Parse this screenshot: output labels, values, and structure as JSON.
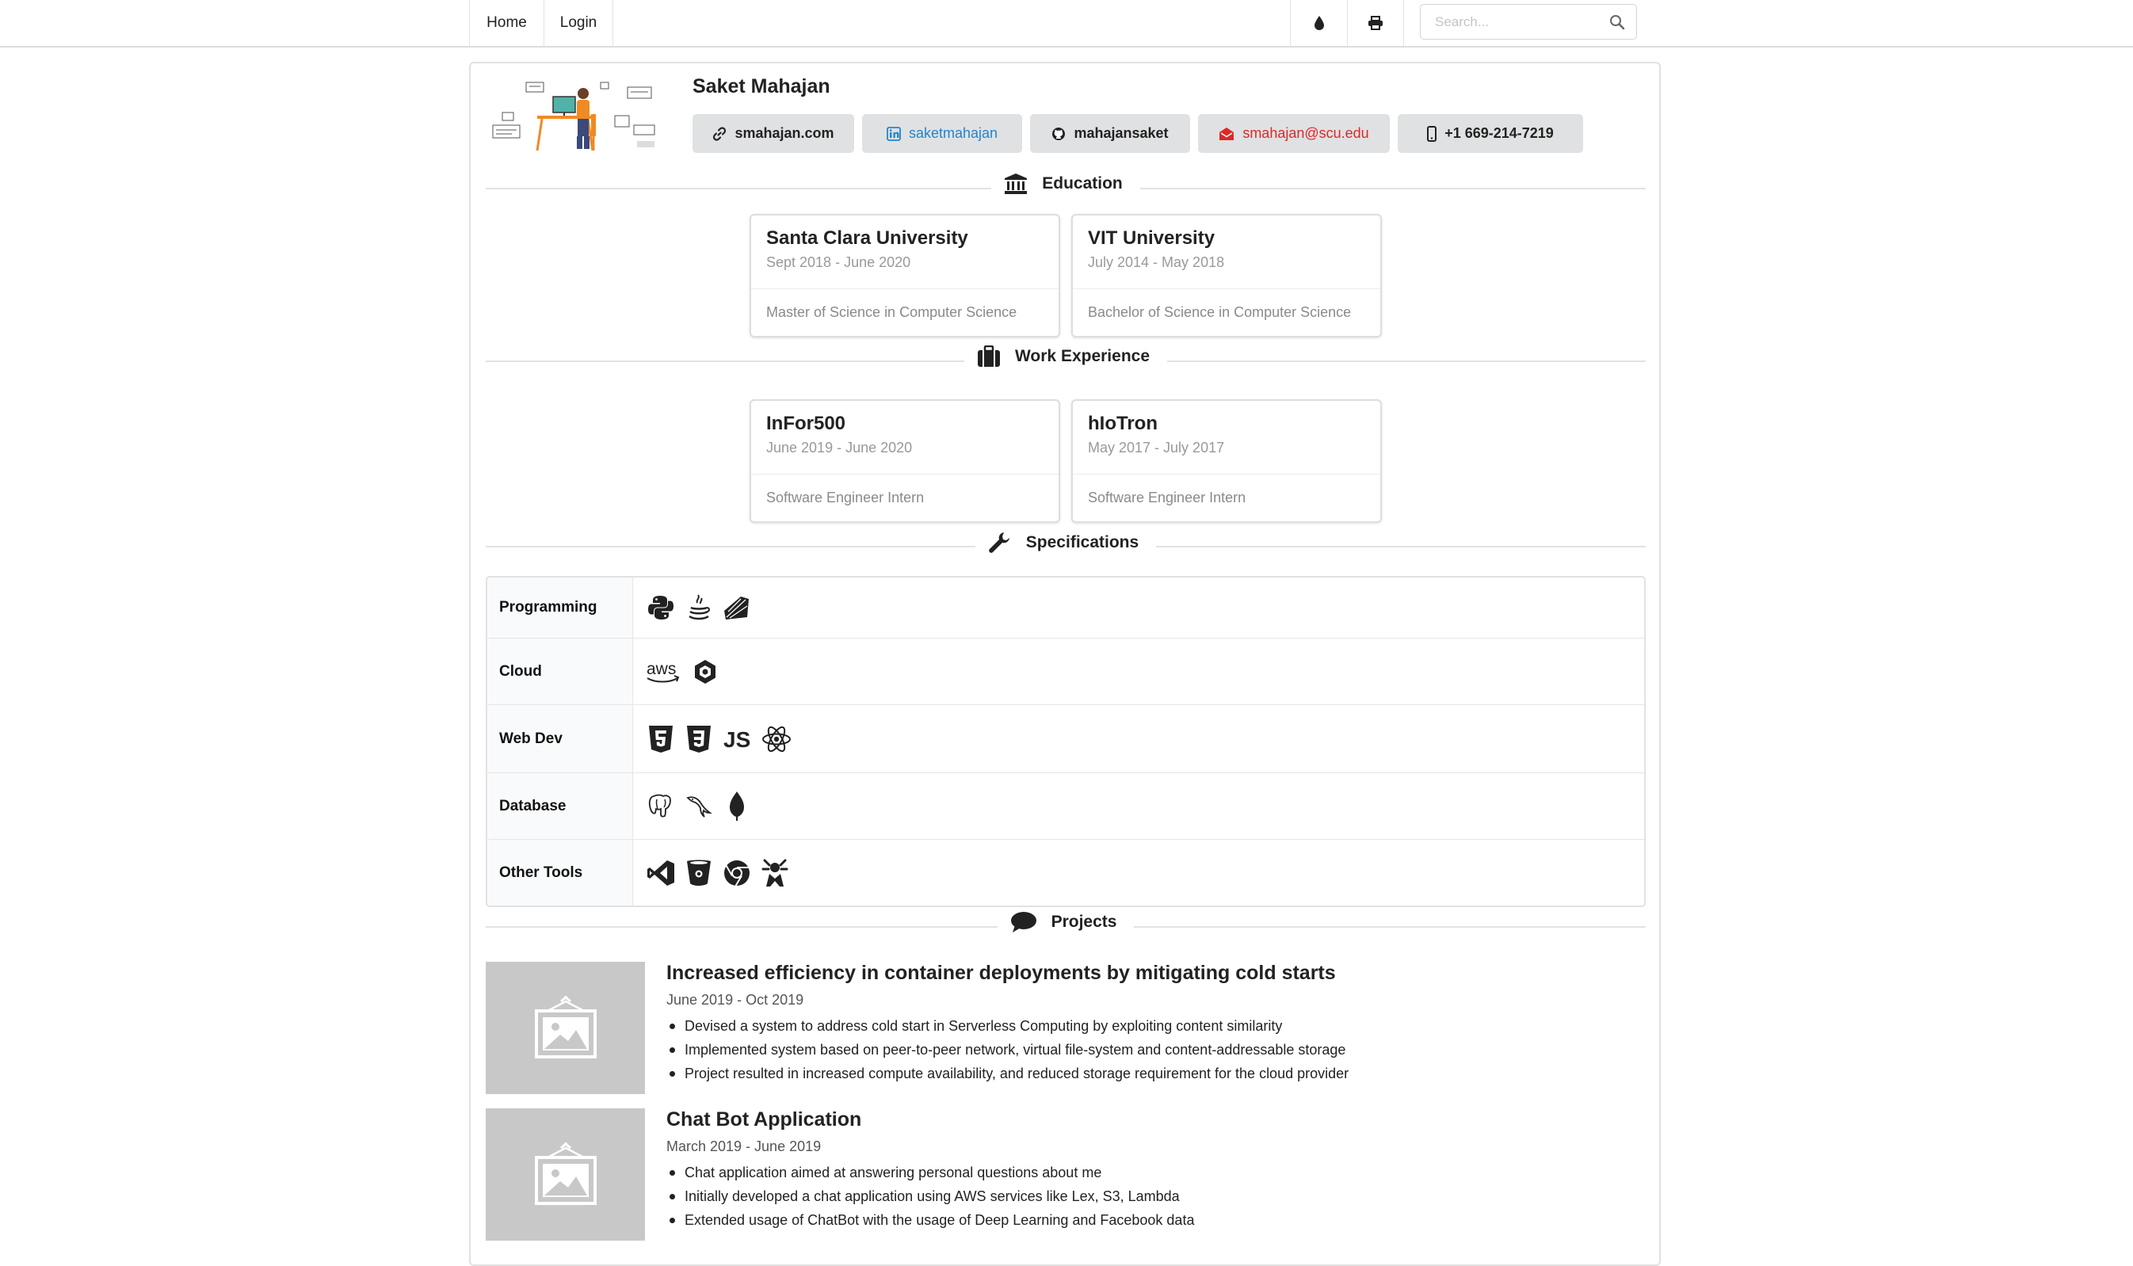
{
  "nav": {
    "home": "Home",
    "login": "Login",
    "theme_icon": "droplet-icon",
    "print_icon": "print-icon",
    "search_placeholder": "Search..."
  },
  "profile": {
    "name": "Saket Mahajan",
    "avatar": "developer-illustration",
    "contacts": [
      {
        "label": "smahajan.com",
        "icon": "link-icon"
      },
      {
        "label": "saketmahajan",
        "icon": "linkedin-icon"
      },
      {
        "label": "mahajansaket",
        "icon": "github-icon"
      },
      {
        "label": "smahajan@scu.edu",
        "icon": "envelope-icon"
      },
      {
        "label": "+1 669-214-7219",
        "icon": "mobile-icon"
      }
    ]
  },
  "education": {
    "heading": "Education",
    "items": [
      {
        "school": "Santa Clara University",
        "dates": "Sept 2018 - June 2020",
        "degree": "Master of Science in Computer Science"
      },
      {
        "school": "VIT University",
        "dates": "July 2014 - May 2018",
        "degree": "Bachelor of Science in Computer Science"
      }
    ]
  },
  "work": {
    "heading": "Work Experience",
    "items": [
      {
        "company": "InFor500",
        "dates": "June 2019 - June 2020",
        "role": "Software Engineer Intern"
      },
      {
        "company": "hIoTron",
        "dates": "May 2017 - July 2017",
        "role": "Software Engineer Intern"
      }
    ]
  },
  "specs": {
    "heading": "Specifications",
    "rows": [
      {
        "label": "Programming",
        "icons": [
          "python-icon",
          "java-icon",
          "ruby-icon"
        ]
      },
      {
        "label": "Cloud",
        "icons": [
          "aws-icon",
          "gcp-icon"
        ],
        "aws_text": "aws"
      },
      {
        "label": "Web Dev",
        "icons": [
          "html5-icon",
          "css3-icon",
          "js-icon",
          "react-icon"
        ],
        "js_text": "JS"
      },
      {
        "label": "Database",
        "icons": [
          "postgresql-icon",
          "mysql-icon",
          "mongodb-icon"
        ]
      },
      {
        "label": "Other Tools",
        "icons": [
          "visual-studio-icon",
          "bitbucket-icon",
          "chrome-icon",
          "jenkins-icon"
        ]
      }
    ]
  },
  "projects": {
    "heading": "Projects",
    "items": [
      {
        "title": "Increased efficiency in container deployments by mitigating cold starts",
        "dates": "June 2019 - Oct 2019",
        "bullets": [
          "Devised a system to address cold start in Serverless Computing by exploiting content similarity",
          "Implemented system based on peer-to-peer network, virtual file-system and content-addressable storage",
          "Project resulted in increased compute availability, and reduced storage requirement for the cloud provider"
        ]
      },
      {
        "title": "Chat Bot Application",
        "dates": "March 2019 - June 2019",
        "bullets": [
          "Chat application aimed at answering personal questions about me",
          "Initially developed a chat application using AWS services like Lex, S3, Lambda",
          "Extended usage of ChatBot with the usage of Deep Learning and Facebook data"
        ]
      }
    ]
  },
  "colors": {
    "linkedin": "#2185d0",
    "email": "#db2828",
    "button_bg": "#e0e1e2",
    "placeholder_bg": "#c8c8c8"
  }
}
